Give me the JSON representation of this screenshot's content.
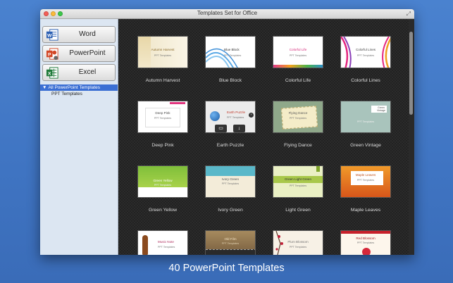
{
  "window": {
    "title": "Templates Set for Office"
  },
  "apps": [
    {
      "label": "Word",
      "icon": "word-icon",
      "color": "#2b5fb3"
    },
    {
      "label": "PowerPoint",
      "icon": "powerpoint-icon",
      "color": "#d24726"
    },
    {
      "label": "Excel",
      "icon": "excel-icon",
      "color": "#1f7a3a"
    }
  ],
  "tree": {
    "selected": "All PowerPoint Templates",
    "child": "PPT Templates"
  },
  "templates": [
    {
      "name": "Autumn Harvest",
      "slide_title": "Autumn Harvest",
      "slide_sub": "PPT Templates"
    },
    {
      "name": "Blue Block",
      "slide_title": "Blue Block",
      "slide_sub": "PPT Templates"
    },
    {
      "name": "Colorful Life",
      "slide_title": "Colorful Life",
      "slide_sub": "PPT Templates"
    },
    {
      "name": "Colorful Lines",
      "slide_title": "Colorful Lines",
      "slide_sub": "PPT Templates"
    },
    {
      "name": "Deep Pink",
      "slide_title": "Deep Pink",
      "slide_sub": "PPT Templates"
    },
    {
      "name": "Earth Puzzle",
      "slide_title": "Earth Puzzle",
      "slide_sub": "PPT Templates"
    },
    {
      "name": "Flying Dance",
      "slide_title": "Flying Dance",
      "slide_sub": "PPT Templates"
    },
    {
      "name": "Green Vintage",
      "slide_title": "Green Vintage",
      "slide_sub": "PPT Templates"
    },
    {
      "name": "Green Yellow",
      "slide_title": "Green Yellow",
      "slide_sub": "PPT Templates"
    },
    {
      "name": "Ivory Green",
      "slide_title": "Ivory Green",
      "slide_sub": "PPT Templates"
    },
    {
      "name": "Light Green",
      "slide_title": "Green Light Green",
      "slide_sub": "PPT Templates"
    },
    {
      "name": "Maple Leaves",
      "slide_title": "Maple Leaves",
      "slide_sub": "PPT Templates"
    },
    {
      "name": "",
      "slide_title": "Music Note",
      "slide_sub": "PPT Templates"
    },
    {
      "name": "",
      "slide_title": "Old Film",
      "slide_sub": "PPT Templates"
    },
    {
      "name": "",
      "slide_title": "Plum Blossom",
      "slide_sub": "PPT Templates"
    },
    {
      "name": "",
      "slide_title": "Red Blossom",
      "slide_sub": "PPT Templates"
    }
  ],
  "caption": "40 PowerPoint Templates"
}
